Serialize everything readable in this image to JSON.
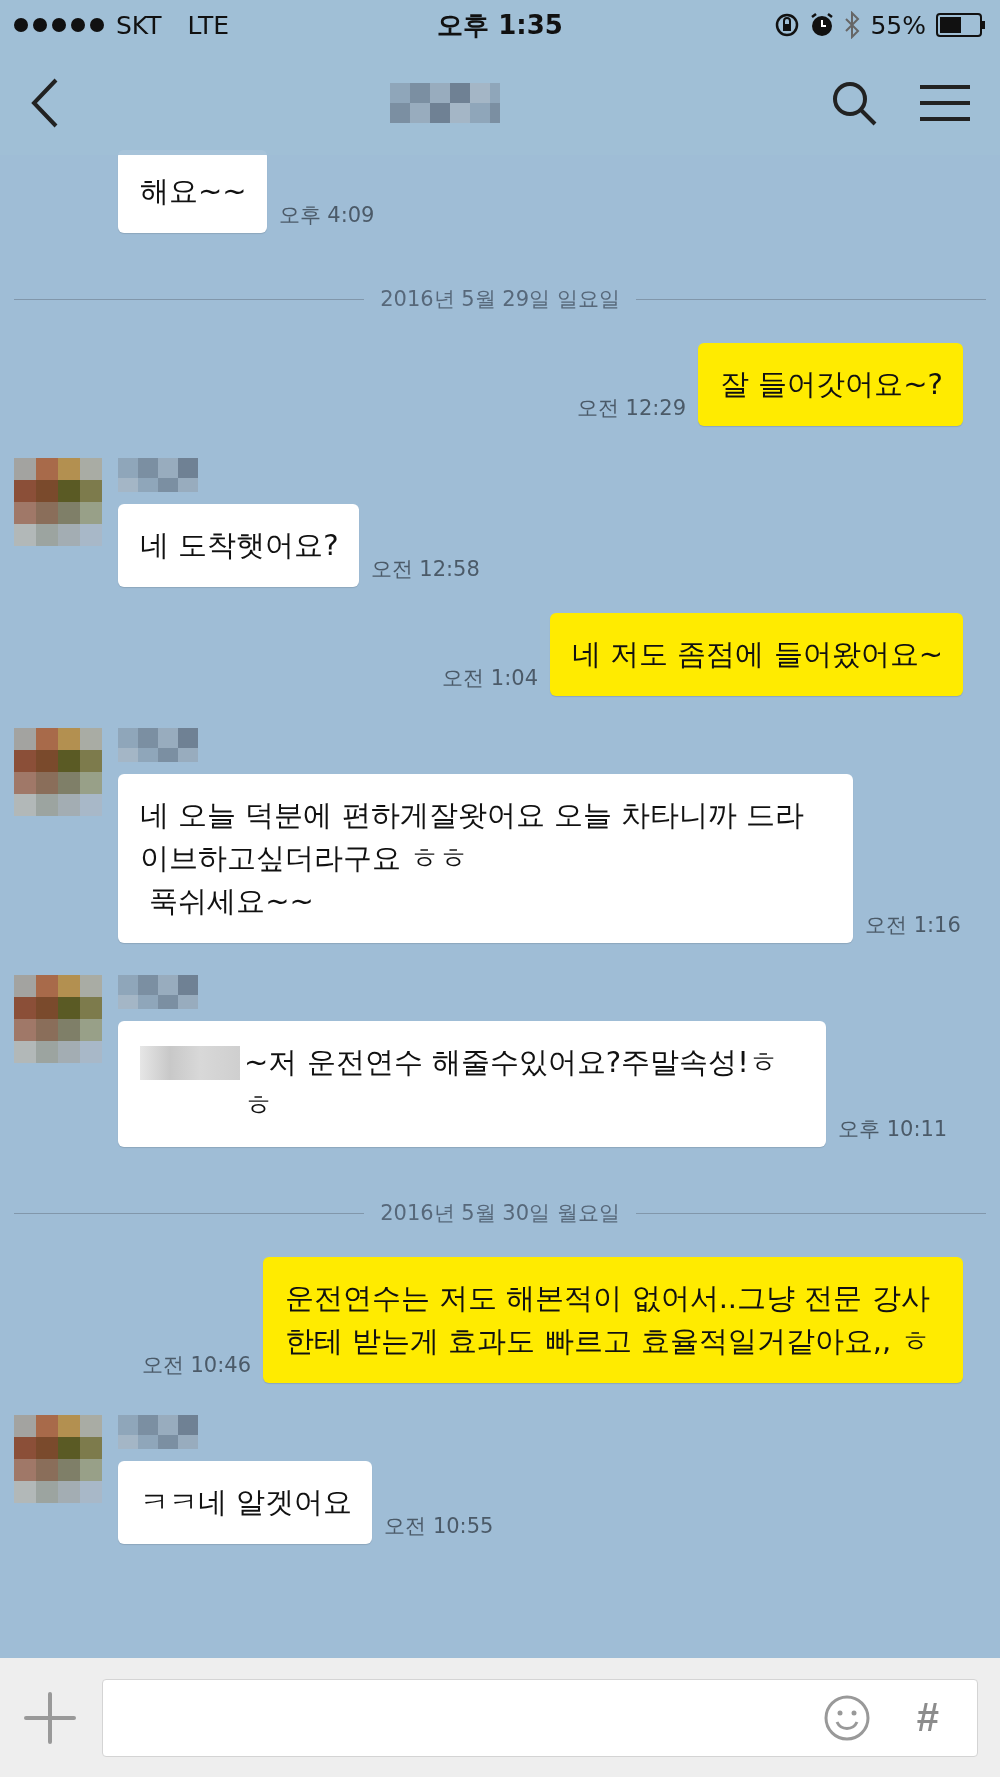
{
  "status_bar": {
    "carrier": "SKT",
    "network": "LTE",
    "time": "오후 1:35",
    "battery": "55%"
  },
  "messages": [
    {
      "kind": "received",
      "profile": false,
      "redacted_prefix": false,
      "text": "해요~~",
      "time": "오후 4:09"
    },
    {
      "kind": "date",
      "text": "2016년 5월 29일 일요일"
    },
    {
      "kind": "sent",
      "text": "잘 들어갓어요~?",
      "time": "오전 12:29"
    },
    {
      "kind": "received",
      "profile": true,
      "redacted_prefix": false,
      "text": "네 도착햇어요?",
      "time": "오전 12:58"
    },
    {
      "kind": "sent",
      "text": "네 저도 좀점에 들어왔어요~",
      "time": "오전 1:04"
    },
    {
      "kind": "received",
      "profile": true,
      "redacted_prefix": false,
      "text": "네 오늘 덕분에 편하게잘왓어요 오늘 차타니까 드라이브하고싶더라구요 ㅎㅎ\n 푹쉬세요~~",
      "time": "오전 1:16"
    },
    {
      "kind": "received",
      "profile": true,
      "redacted_prefix": true,
      "text": "~저 운전연수 해줄수있어요?주말속성!ㅎㅎ",
      "time": "오후 10:11"
    },
    {
      "kind": "date",
      "text": "2016년 5월 30일 월요일"
    },
    {
      "kind": "sent",
      "text": "운전연수는 저도 해본적이 없어서..그냥 전문 강사한테 받는게 효과도 빠르고 효율적일거같아요,, ㅎ",
      "time": "오전 10:46"
    },
    {
      "kind": "received",
      "profile": true,
      "redacted_prefix": false,
      "text": "ㅋㅋ네 알겟어요",
      "time": "오전 10:55"
    }
  ],
  "input_bar": {
    "hash_key": "#"
  }
}
